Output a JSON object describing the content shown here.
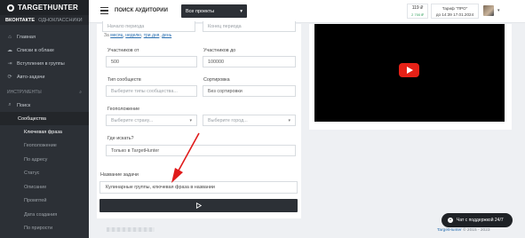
{
  "app": {
    "logo_text": "TARGETHUNTER",
    "network_tabs": [
      "ВКОНТАКТЕ",
      "ОДНОКЛАССНИКИ"
    ]
  },
  "sidebar": {
    "items": [
      {
        "label": "Главная",
        "icon": "home-icon"
      },
      {
        "label": "Списки в облаке",
        "icon": "cloud-icon"
      },
      {
        "label": "Вступления в группы",
        "icon": "join-icon"
      },
      {
        "label": "Авто-задачи",
        "icon": "auto-icon"
      }
    ],
    "section_label": "ИНСТРУМЕНТЫ",
    "search_label": "Поиск",
    "group_label": "Сообщества",
    "sub_items": [
      "Ключевая фраза",
      "Геоположение",
      "По адресу",
      "Статус",
      "Описание",
      "Промптей",
      "Дата создания",
      "По прирости"
    ]
  },
  "header": {
    "title": "ПОИСК АУДИТОРИИ",
    "project_select": "Все проекты",
    "balance_value": "119 ₽",
    "balance_sub": "2 700 ₽",
    "tariff_line1": "Тариф \"ПРО\"",
    "tariff_line2": "до 14:39 17.01.2024"
  },
  "form": {
    "period_start_placeholder": "Начало периода",
    "period_end_placeholder": "Конец периода",
    "period_links_prefix": "За",
    "period_links": [
      "месяц",
      "неделю",
      "три дня",
      "день"
    ],
    "members_from_label": "Участников от",
    "members_from_value": "500",
    "members_to_label": "Участников до",
    "members_to_value": "100000",
    "type_label": "Тип сообществ",
    "type_placeholder": "Выберите типы сообщества...",
    "sort_label": "Сортировка",
    "sort_value": "Без сортировки",
    "geo_label": "Геоположение",
    "country_placeholder": "Выберите страну...",
    "city_placeholder": "Выберите город...",
    "where_label": "Где искать?",
    "where_value": "Только в TargetHunter"
  },
  "task": {
    "name_label": "Название задачи",
    "name_value": "Кулинарные группы, ключевая фраза в названии",
    "run_icon": "play-icon"
  },
  "video": {
    "icon": "youtube-play-icon"
  },
  "footer": {
    "brand": "TargetHunter",
    "copyright": " © 2015 - 2023",
    "support_label": "Чат с поддержкой 24/7"
  },
  "colors": {
    "sidebar_bg": "#2c3036",
    "accent_link": "#2a6fb0",
    "youtube_red": "#e62117",
    "annotation_arrow": "#e01b1b"
  }
}
